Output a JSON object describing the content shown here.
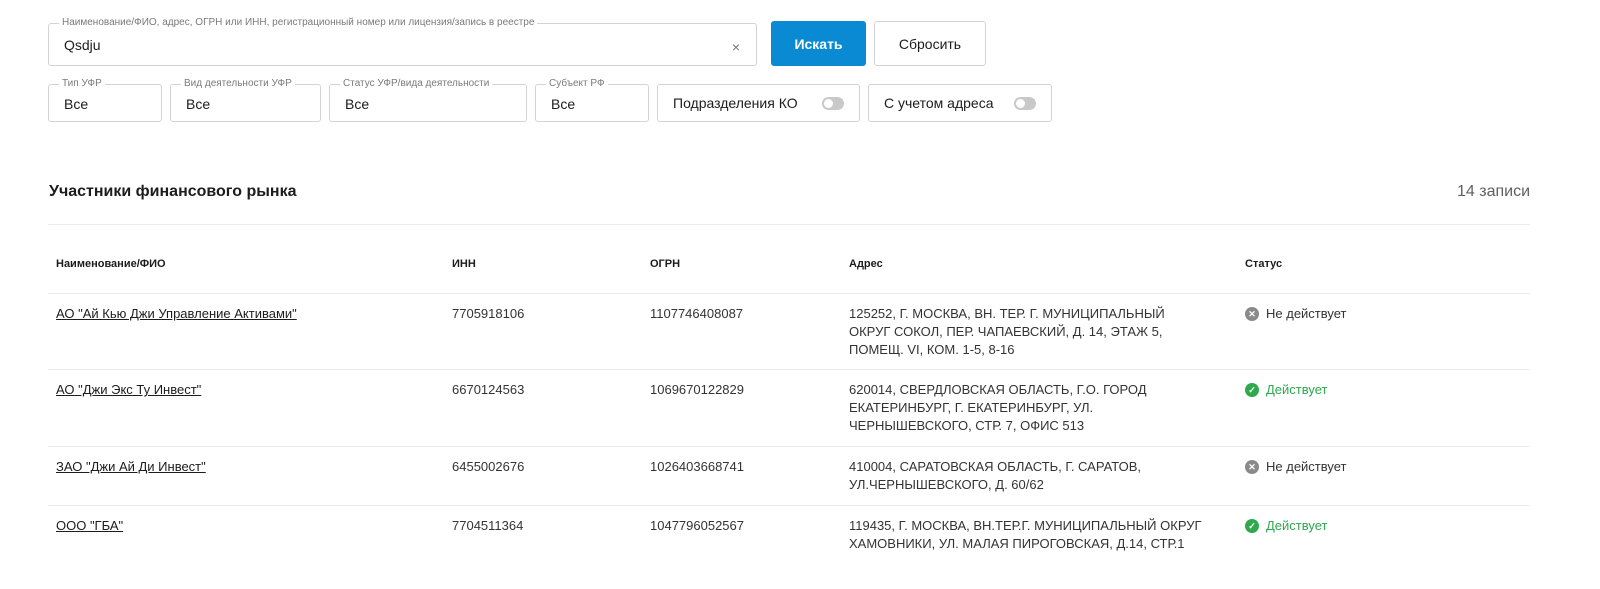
{
  "search": {
    "legend": "Наименование/ФИО, адрес, ОГРН или ИНН, регистрационный номер или лицензия/запись в реестре",
    "value": "Qsdju",
    "clear_glyph": "×",
    "search_label": "Искать",
    "reset_label": "Сбросить"
  },
  "filters": [
    {
      "legend": "Тип УФР",
      "value": "Все"
    },
    {
      "legend": "Вид деятельности УФР",
      "value": "Все"
    },
    {
      "legend": "Статус УФР/вида деятельности",
      "value": "Все"
    },
    {
      "legend": "Субъект РФ",
      "value": "Все"
    }
  ],
  "toggles": [
    {
      "label": "Подразделения КО",
      "on": false
    },
    {
      "label": "С учетом адреса",
      "on": false
    }
  ],
  "section": {
    "title": "Участники финансового рынка",
    "count": "14 записи"
  },
  "table": {
    "headers": [
      "Наименование/ФИО",
      "ИНН",
      "ОГРН",
      "Адрес",
      "Статус"
    ],
    "rows": [
      {
        "name": "АО \"Ай Кью Джи Управление Активами\"",
        "inn": "7705918106",
        "ogrn": "1107746408087",
        "address": "125252, Г. МОСКВА, ВН. ТЕР. Г. МУНИЦИПАЛЬНЫЙ ОКРУГ СОКОЛ, ПЕР. ЧАПАЕВСКИЙ, Д. 14, ЭТАЖ 5, ПОМЕЩ. VI, КОМ. 1-5, 8-16",
        "status": "Не действует",
        "status_type": "inactive"
      },
      {
        "name": "АО \"Джи Экс Ту Инвест\"",
        "inn": "6670124563",
        "ogrn": "1069670122829",
        "address": "620014, СВЕРДЛОВСКАЯ ОБЛАСТЬ, Г.О. ГОРОД ЕКАТЕРИНБУРГ, Г. ЕКАТЕРИНБУРГ, УЛ. ЧЕРНЫШЕВСКОГО, СТР. 7, ОФИС 513",
        "status": "Действует",
        "status_type": "active"
      },
      {
        "name": "ЗАО \"Джи Ай Ди Инвест\"",
        "inn": "6455002676",
        "ogrn": "1026403668741",
        "address": "410004, САРАТОВСКАЯ ОБЛАСТЬ, Г. САРАТОВ, УЛ.ЧЕРНЫШЕВСКОГО, Д. 60/62",
        "status": "Не действует",
        "status_type": "inactive"
      },
      {
        "name": "ООО \"ГБА\"",
        "inn": "7704511364",
        "ogrn": "1047796052567",
        "address": "119435, Г. МОСКВА, ВН.ТЕР.Г. МУНИЦИПАЛЬНЫЙ ОКРУГ ХАМОВНИКИ, УЛ. МАЛАЯ ПИРОГОВСКАЯ, Д.14, СТР.1",
        "status": "Действует",
        "status_type": "active"
      }
    ]
  },
  "colors": {
    "accent": "#0a8ad2",
    "active": "#2fa84f",
    "inactive": "#8a8a8a"
  }
}
